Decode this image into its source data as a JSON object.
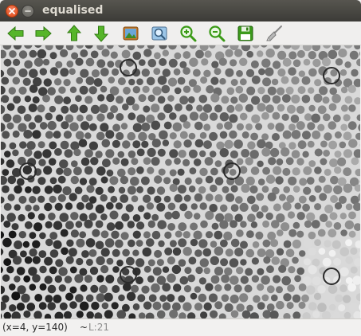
{
  "window": {
    "title": "equalised"
  },
  "toolbar": {
    "buttons": [
      {
        "name": "back-button",
        "icon": "arrow-left-icon"
      },
      {
        "name": "forward-button",
        "icon": "arrow-right-icon"
      },
      {
        "name": "up-button",
        "icon": "arrow-up-icon"
      },
      {
        "name": "down-button",
        "icon": "arrow-down-icon"
      },
      {
        "name": "image-button",
        "icon": "picture-icon"
      },
      {
        "name": "zoom-fit-button",
        "icon": "zoom-fit-icon"
      },
      {
        "name": "zoom-in-button",
        "icon": "zoom-in-icon"
      },
      {
        "name": "zoom-out-button",
        "icon": "zoom-out-icon"
      },
      {
        "name": "save-button",
        "icon": "floppy-disk-icon"
      },
      {
        "name": "clear-button",
        "icon": "broom-icon"
      }
    ]
  },
  "viewer": {
    "description_icon": "cell-grid-image"
  },
  "status": {
    "coords": "(x=4, y=140)",
    "separator": "~",
    "level": "L:21"
  },
  "colors": {
    "titlebar": "#3c3b37",
    "close": "#df4a16",
    "arrow_green": "#4caf1e",
    "zoom_green": "#3a9a16"
  }
}
